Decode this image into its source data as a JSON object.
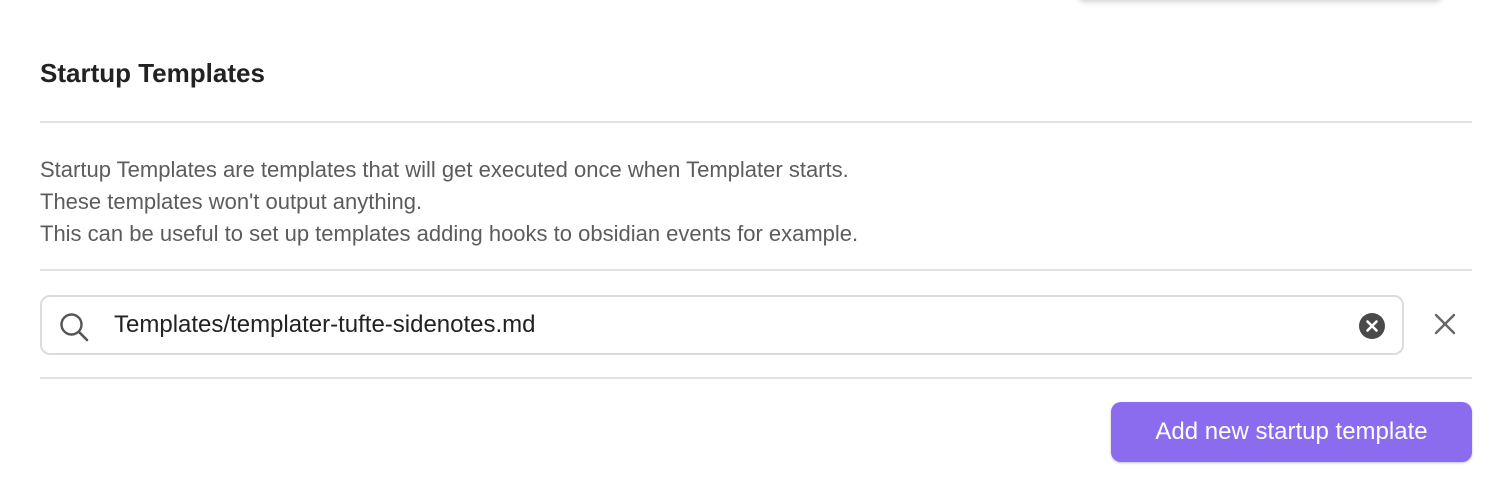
{
  "section": {
    "title": "Startup Templates"
  },
  "description": {
    "lines": [
      "Startup Templates are templates that will get executed once when Templater starts.",
      "These templates won't output anything.",
      "This can be useful to set up templates adding hooks to obsidian events for example."
    ]
  },
  "template_row": {
    "search_icon": "search-icon",
    "value": "Templates/templater-tufte-sidenotes.md",
    "clear_icon": "circle-x-icon",
    "remove_icon": "close-icon"
  },
  "add_button": {
    "label": "Add new startup template"
  },
  "colors": {
    "accent": "#8b6cef",
    "text_primary": "#222222",
    "text_muted": "#5c5c5c",
    "divider": "#e3e3e3"
  }
}
